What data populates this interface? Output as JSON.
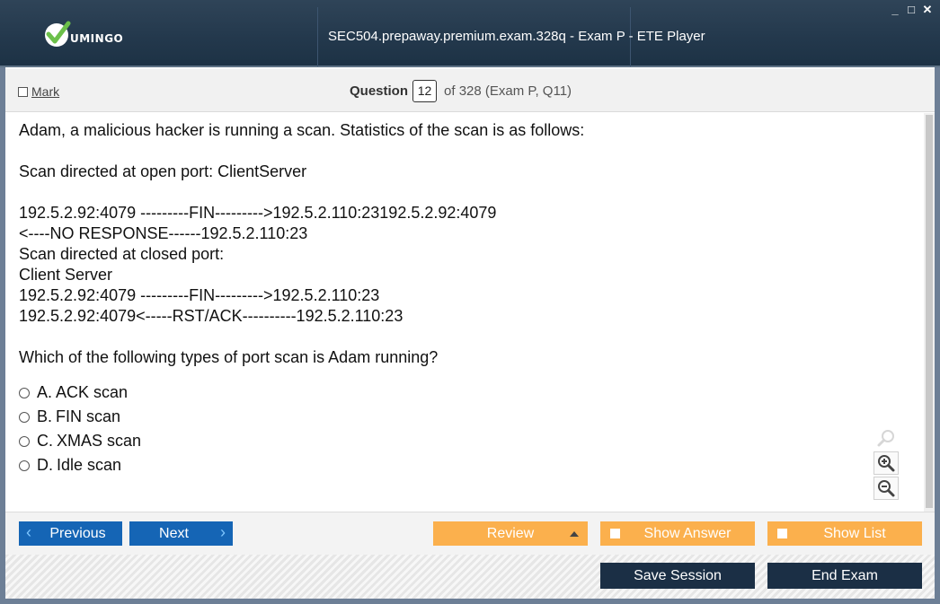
{
  "window": {
    "title": "SEC504.prepaway.premium.exam.328q - Exam P - ETE Player",
    "logo_text": "UMINGO",
    "controls": [
      "_",
      "□",
      "✕"
    ]
  },
  "header": {
    "mark_label": "Mark",
    "question_label": "Question",
    "question_number": "12",
    "question_of": "of 328 (Exam P, Q11)"
  },
  "question": {
    "lines": [
      "Adam, a malicious hacker is running a scan. Statistics of the scan is as follows:",
      "",
      "Scan directed at open port: ClientServer",
      "",
      "192.5.2.92:4079 ---------FIN--------->192.5.2.110:23192.5.2.92:4079",
      "<----NO RESPONSE------192.5.2.110:23",
      "Scan directed at closed port:",
      "Client Server",
      "192.5.2.92:4079 ---------FIN--------->192.5.2.110:23",
      "192.5.2.92:4079<-----RST/ACK----------192.5.2.110:23",
      "",
      "Which of the following types of port scan is Adam running?"
    ],
    "options": [
      {
        "letter": "A.",
        "text": "ACK scan"
      },
      {
        "letter": "B.",
        "text": "FIN scan"
      },
      {
        "letter": "C.",
        "text": "XMAS scan"
      },
      {
        "letter": "D.",
        "text": "Idle scan"
      }
    ]
  },
  "nav": {
    "previous": "Previous",
    "next": "Next",
    "review": "Review",
    "show_answer": "Show Answer",
    "show_list": "Show List",
    "save_session": "Save Session",
    "end_exam": "End Exam"
  },
  "colors": {
    "titlebar": "#23384c",
    "nav_blue": "#1565b5",
    "orange": "#fbb04d",
    "dark_button": "#1b2f45"
  },
  "icons": [
    "logo-check-icon",
    "minimize-icon",
    "maximize-icon",
    "close-icon",
    "search-zoom-icon",
    "zoom-in-icon",
    "zoom-out-icon",
    "chevron-left-icon",
    "chevron-right-icon",
    "caret-up-icon"
  ]
}
